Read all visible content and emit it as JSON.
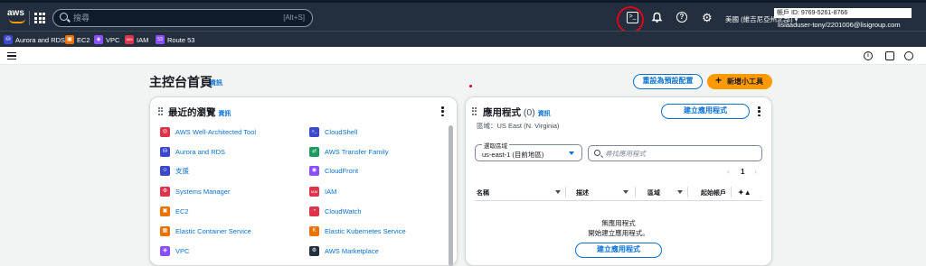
{
  "topnav": {
    "logo_text": "aws",
    "search_placeholder": "搜尋",
    "search_shortcut": "[Alt+S]",
    "cloudshell_glyph": ">_",
    "region": "美國 (維吉尼亞州北部) ▾",
    "account_id": "帳戶 ID: 9769-5261-8766",
    "account_user": "lisiaaduser-tony/2201006@lisigroup.com",
    "help_glyph": "?",
    "gear_glyph": "⚙",
    "bell_glyph": "🔔"
  },
  "favorites": [
    {
      "label": "Aurora and RDS",
      "icon": "rds-icon",
      "color": "#3b48cc",
      "glyph": "⛁"
    },
    {
      "label": "EC2",
      "icon": "ec2-icon",
      "color": "#ed7100",
      "glyph": "▣"
    },
    {
      "label": "VPC",
      "icon": "vpc-icon",
      "color": "#8c4fff",
      "glyph": "◈"
    },
    {
      "label": "IAM",
      "icon": "iam-icon",
      "color": "#dd344c",
      "glyph": "IAM"
    },
    {
      "label": "Route 53",
      "icon": "route53-icon",
      "color": "#8c4fff",
      "glyph": "53"
    }
  ],
  "page": {
    "title": "主控台首頁",
    "info": "資訊",
    "reset_button": "重設為預設配置",
    "add_widget_button": "新增小工具"
  },
  "recent": {
    "title": "最近的瀏覽",
    "info": "資訊",
    "col1": [
      {
        "label": "AWS Well-Architected Tool",
        "color": "#dd344c",
        "glyph": "◎"
      },
      {
        "label": "Aurora and RDS",
        "color": "#3b48cc",
        "glyph": "⛁"
      },
      {
        "label": "支援",
        "color": "#3b48cc",
        "glyph": "☺"
      },
      {
        "label": "Systems Manager",
        "color": "#dd344c",
        "glyph": "⚙"
      },
      {
        "label": "EC2",
        "color": "#ed7100",
        "glyph": "▣"
      },
      {
        "label": "Elastic Container Service",
        "color": "#ed7100",
        "glyph": "▦"
      },
      {
        "label": "VPC",
        "color": "#8c4fff",
        "glyph": "◈"
      }
    ],
    "col2": [
      {
        "label": "CloudShell",
        "color": "#3b48cc",
        "glyph": ">_"
      },
      {
        "label": "AWS Transfer Family",
        "color": "#1b9b5e",
        "glyph": "⇄"
      },
      {
        "label": "CloudFront",
        "color": "#8c4fff",
        "glyph": "◉"
      },
      {
        "label": "IAM",
        "color": "#dd344c",
        "glyph": "IAM"
      },
      {
        "label": "CloudWatch",
        "color": "#dd344c",
        "glyph": "◔"
      },
      {
        "label": "Elastic Kubernetes Service",
        "color": "#ed7100",
        "glyph": "K"
      },
      {
        "label": "AWS Marketplace",
        "color": "#232f3e",
        "glyph": "⚙"
      }
    ]
  },
  "apps": {
    "title": "應用程式",
    "count": "(0)",
    "info": "資訊",
    "create_button": "建立應用程式",
    "region_line": "區域：US East (N. Virginia)",
    "select_label": "選取區域",
    "select_value": "us-east-1 (目前地區)",
    "search_placeholder": "尋找應用程式",
    "page_number": "1",
    "prev": "‹",
    "next": "›",
    "columns": [
      "名稱",
      "描述",
      "區域",
      "起始帳戶"
    ],
    "empty_title": "無應用程式",
    "empty_subtitle": "開始建立應用程式。",
    "empty_button": "建立應用程式"
  }
}
